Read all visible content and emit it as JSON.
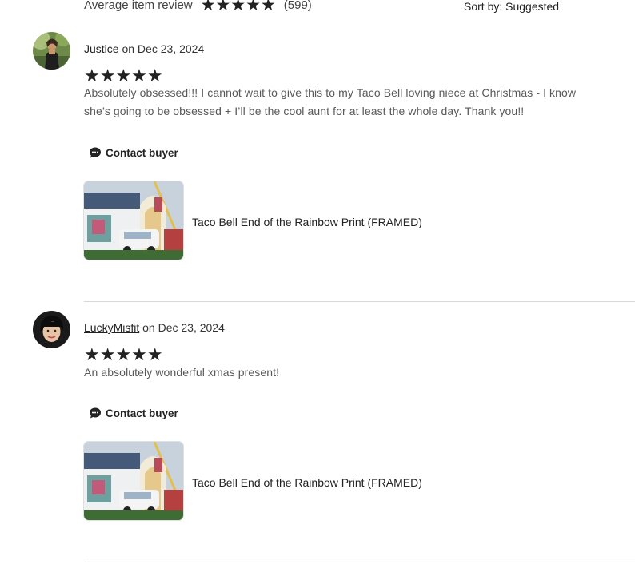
{
  "summary": {
    "label": "Average item review",
    "stars": "★★★★★",
    "count": "(599)",
    "sort_label": "Sort by: Suggested"
  },
  "reviews": [
    {
      "username": "Justice",
      "date_text": " on Dec 23, 2024",
      "stars": "★★★★★",
      "text": "Absolutely obsessed!!! I cannot wait to give this to my Taco Bell loving niece at Christmas - I know she’s going to be obsessed + I’ll be the cool aunt for at least the whole day. Thank you!!",
      "contact_label": "Contact buyer",
      "product_title": "Taco Bell End of the Rainbow Print (FRAMED)"
    },
    {
      "username": "LuckyMisfit",
      "date_text": " on Dec 23, 2024",
      "stars": "★★★★★",
      "text": "An absolutely wonderful xmas present!",
      "contact_label": "Contact buyer",
      "product_title": "Taco Bell End of the Rainbow Print (FRAMED)"
    }
  ],
  "icons": {
    "chat": "chat-bubble-icon",
    "star": "star-icon"
  },
  "colors": {
    "text_primary": "#222222",
    "text_secondary": "#595959",
    "divider": "#d8d8d8"
  }
}
